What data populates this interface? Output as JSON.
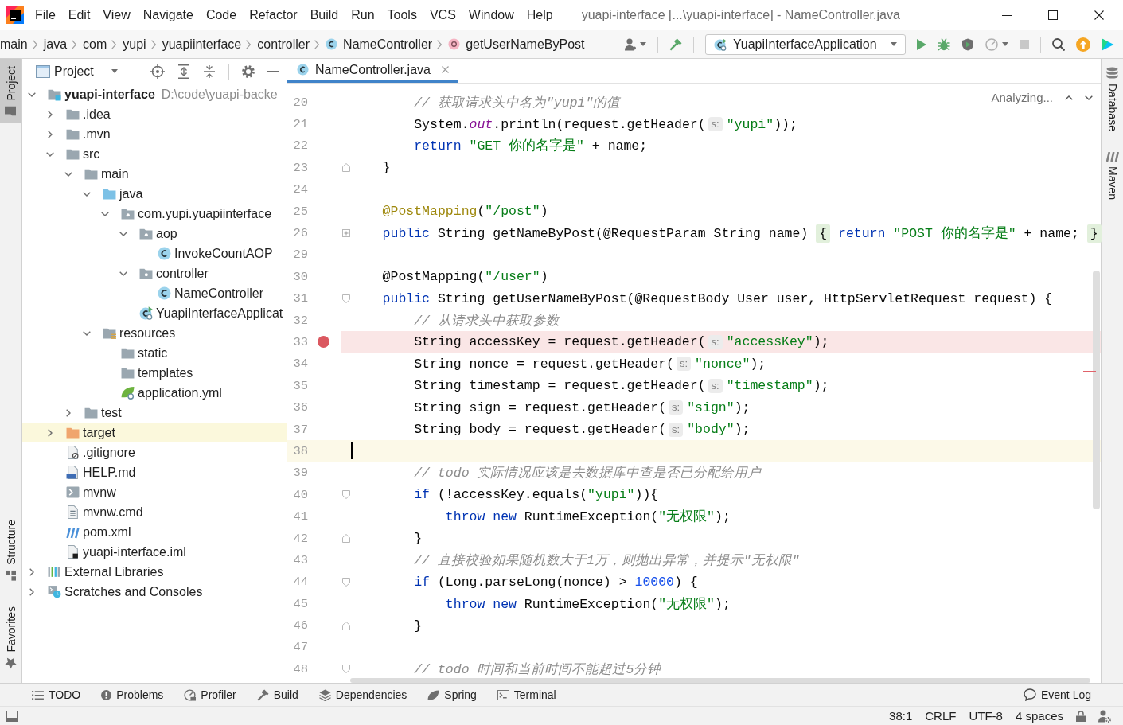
{
  "window": {
    "title": "yuapi-interface [...\\yuapi-interface] - NameController.java"
  },
  "menu": [
    {
      "label": "File"
    },
    {
      "label": "Edit"
    },
    {
      "label": "View"
    },
    {
      "label": "Navigate"
    },
    {
      "label": "Code"
    },
    {
      "label": "Refactor"
    },
    {
      "label": "Build"
    },
    {
      "label": "Run"
    },
    {
      "label": "Tools"
    },
    {
      "label": "VCS"
    },
    {
      "label": "Window"
    },
    {
      "label": "Help"
    }
  ],
  "breadcrumbs": [
    {
      "label": "main",
      "kind": "folder"
    },
    {
      "label": "java",
      "kind": "folder"
    },
    {
      "label": "com",
      "kind": "folder"
    },
    {
      "label": "yupi",
      "kind": "folder"
    },
    {
      "label": "yuapiinterface",
      "kind": "folder"
    },
    {
      "label": "controller",
      "kind": "folder"
    },
    {
      "label": "NameController",
      "kind": "class"
    },
    {
      "label": "getUserNameByPost",
      "kind": "method"
    }
  ],
  "run_config": {
    "label": "YuapiInterfaceApplication"
  },
  "left_tool_stripe": [
    {
      "label": "Project",
      "selected": true
    },
    {
      "label": "Structure",
      "selected": false
    },
    {
      "label": "Favorites",
      "selected": false
    }
  ],
  "project_panel": {
    "title": "Project",
    "tree": [
      {
        "label": "yuapi-interface",
        "path": "D:\\code\\yuapi-backe",
        "kind": "module",
        "expanded": true,
        "selected": false,
        "children": [
          {
            "label": ".idea",
            "kind": "folder",
            "expanded": false,
            "selected": false
          },
          {
            "label": ".mvn",
            "kind": "folder",
            "expanded": false,
            "selected": false
          },
          {
            "label": "src",
            "kind": "folder",
            "expanded": true,
            "selected": false,
            "children": [
              {
                "label": "main",
                "kind": "folder",
                "expanded": true,
                "selected": false,
                "children": [
                  {
                    "label": "java",
                    "kind": "source-root",
                    "expanded": true,
                    "selected": false,
                    "children": [
                      {
                        "label": "com.yupi.yuapiinterface",
                        "kind": "package",
                        "expanded": true,
                        "selected": false,
                        "children": [
                          {
                            "label": "aop",
                            "kind": "package",
                            "expanded": true,
                            "selected": false,
                            "children": [
                              {
                                "label": "InvokeCountAOP",
                                "kind": "class",
                                "selected": false
                              }
                            ]
                          },
                          {
                            "label": "controller",
                            "kind": "package",
                            "expanded": true,
                            "selected": false,
                            "children": [
                              {
                                "label": "NameController",
                                "kind": "class",
                                "selected": false
                              }
                            ]
                          },
                          {
                            "label": "YuapiInterfaceApplicat",
                            "kind": "spring-app",
                            "selected": false
                          }
                        ]
                      }
                    ]
                  },
                  {
                    "label": "resources",
                    "kind": "resources-root",
                    "expanded": true,
                    "selected": false,
                    "children": [
                      {
                        "label": "static",
                        "kind": "folder",
                        "selected": false
                      },
                      {
                        "label": "templates",
                        "kind": "folder",
                        "selected": false
                      },
                      {
                        "label": "application.yml",
                        "kind": "spring-config",
                        "selected": false
                      }
                    ]
                  }
                ]
              },
              {
                "label": "test",
                "kind": "folder",
                "expanded": false,
                "selected": false
              }
            ]
          },
          {
            "label": "target",
            "kind": "excluded-folder",
            "expanded": false,
            "selected": true
          },
          {
            "label": ".gitignore",
            "kind": "ignored-file",
            "selected": false
          },
          {
            "label": "HELP.md",
            "kind": "markdown",
            "selected": false
          },
          {
            "label": "mvnw",
            "kind": "script",
            "selected": false
          },
          {
            "label": "mvnw.cmd",
            "kind": "text-file",
            "selected": false
          },
          {
            "label": "pom.xml",
            "kind": "maven",
            "selected": false
          },
          {
            "label": "yuapi-interface.iml",
            "kind": "module-file",
            "selected": false
          }
        ]
      },
      {
        "label": "External Libraries",
        "kind": "libraries",
        "expanded": false,
        "selected": false
      },
      {
        "label": "Scratches and Consoles",
        "kind": "scratches",
        "expanded": false,
        "selected": false
      }
    ]
  },
  "editor": {
    "tabs": [
      {
        "label": "NameController.java",
        "selected": true
      }
    ],
    "status": "Analyzing...",
    "lines": [
      {
        "number": "20",
        "kind": "plain",
        "breakpoint": false,
        "caret": false,
        "parts": [
          {
            "kind": "comment",
            "text": "        // 获取请求头中名为\"yupi\"的值"
          }
        ]
      },
      {
        "number": "21",
        "kind": "plain",
        "breakpoint": false,
        "caret": false,
        "parts": [
          {
            "kind": "plain",
            "text": "        System."
          },
          {
            "kind": "field",
            "text": "out"
          },
          {
            "kind": "plain",
            "text": ".println(request.getHeader("
          },
          {
            "kind": "hint",
            "text": "s:"
          },
          {
            "kind": "string",
            "text": "\"yupi\""
          },
          {
            "kind": "plain",
            "text": "));"
          }
        ]
      },
      {
        "number": "22",
        "kind": "plain",
        "breakpoint": false,
        "caret": false,
        "parts": [
          {
            "kind": "keyword",
            "text": "        return "
          },
          {
            "kind": "string",
            "text": "\"GET 你的名字是\""
          },
          {
            "kind": "plain",
            "text": " + name;"
          }
        ]
      },
      {
        "number": "23",
        "kind": "fold-end",
        "breakpoint": false,
        "caret": false,
        "parts": [
          {
            "kind": "plain",
            "text": "    }"
          }
        ]
      },
      {
        "number": "24",
        "kind": "plain",
        "breakpoint": false,
        "caret": false
      },
      {
        "number": "25",
        "kind": "plain",
        "breakpoint": false,
        "caret": false,
        "parts": [
          {
            "kind": "annotation",
            "text": "    @PostMapping"
          },
          {
            "kind": "plain",
            "text": "("
          },
          {
            "kind": "string",
            "text": "\"/post\""
          },
          {
            "kind": "plain",
            "text": ")"
          }
        ]
      },
      {
        "number": "26",
        "kind": "folded",
        "breakpoint": false,
        "caret": false,
        "parts": [
          {
            "kind": "keyword",
            "text": "    public"
          },
          {
            "kind": "plain",
            "text": " String getNameByPost(@RequestParam String name) "
          },
          {
            "kind": "folded",
            "text": "{"
          },
          {
            "kind": "keyword",
            "text": " return "
          },
          {
            "kind": "string",
            "text": "\"POST 你的名字是\""
          },
          {
            "kind": "plain",
            "text": " + name; "
          },
          {
            "kind": "folded",
            "text": "}"
          }
        ]
      },
      {
        "number": "29",
        "kind": "plain",
        "breakpoint": false,
        "caret": false
      },
      {
        "number": "30",
        "kind": "plain",
        "breakpoint": false,
        "caret": false,
        "parts": [
          {
            "kind": "plain",
            "text": "    @PostMapping("
          },
          {
            "kind": "string",
            "text": "\"/user\""
          },
          {
            "kind": "plain",
            "text": ")"
          }
        ]
      },
      {
        "number": "31",
        "kind": "fold-start",
        "breakpoint": false,
        "caret": false,
        "parts": [
          {
            "kind": "keyword",
            "text": "    public"
          },
          {
            "kind": "plain",
            "text": " String getUserNameByPost(@RequestBody User user, HttpServletRequest request) {"
          }
        ]
      },
      {
        "number": "32",
        "kind": "plain",
        "breakpoint": false,
        "caret": false,
        "parts": [
          {
            "kind": "comment",
            "text": "        // 从请求头中获取参数"
          }
        ]
      },
      {
        "number": "33",
        "kind": "plain",
        "breakpoint": true,
        "caret": false,
        "parts": [
          {
            "kind": "plain",
            "text": "        String accessKey = request.getHeader("
          },
          {
            "kind": "hint",
            "text": "s:"
          },
          {
            "kind": "string",
            "text": "\"accessKey\""
          },
          {
            "kind": "plain",
            "text": ");"
          }
        ]
      },
      {
        "number": "34",
        "kind": "plain",
        "breakpoint": false,
        "caret": false,
        "parts": [
          {
            "kind": "plain",
            "text": "        String nonce = request.getHeader("
          },
          {
            "kind": "hint",
            "text": "s:"
          },
          {
            "kind": "string",
            "text": "\"nonce\""
          },
          {
            "kind": "plain",
            "text": ");"
          }
        ]
      },
      {
        "number": "35",
        "kind": "plain",
        "breakpoint": false,
        "caret": false,
        "parts": [
          {
            "kind": "plain",
            "text": "        String timestamp = request.getHeader("
          },
          {
            "kind": "hint",
            "text": "s:"
          },
          {
            "kind": "string",
            "text": "\"timestamp\""
          },
          {
            "kind": "plain",
            "text": ");"
          }
        ]
      },
      {
        "number": "36",
        "kind": "plain",
        "breakpoint": false,
        "caret": false,
        "parts": [
          {
            "kind": "plain",
            "text": "        String sign = request.getHeader("
          },
          {
            "kind": "hint",
            "text": "s:"
          },
          {
            "kind": "string",
            "text": "\"sign\""
          },
          {
            "kind": "plain",
            "text": ");"
          }
        ]
      },
      {
        "number": "37",
        "kind": "plain",
        "breakpoint": false,
        "caret": false,
        "parts": [
          {
            "kind": "plain",
            "text": "        String body = request.getHeader("
          },
          {
            "kind": "hint",
            "text": "s:"
          },
          {
            "kind": "string",
            "text": "\"body\""
          },
          {
            "kind": "plain",
            "text": ");"
          }
        ]
      },
      {
        "number": "38",
        "kind": "plain",
        "breakpoint": false,
        "caret": true
      },
      {
        "number": "39",
        "kind": "plain",
        "breakpoint": false,
        "caret": false,
        "parts": [
          {
            "kind": "comment",
            "text": "        // todo 实际情况应该是去数据库中查是否已分配给用户"
          }
        ]
      },
      {
        "number": "40",
        "kind": "fold-start",
        "breakpoint": false,
        "caret": false,
        "parts": [
          {
            "kind": "keyword",
            "text": "        if"
          },
          {
            "kind": "plain",
            "text": " (!accessKey.equals("
          },
          {
            "kind": "string",
            "text": "\"yupi\""
          },
          {
            "kind": "plain",
            "text": ")){"
          }
        ]
      },
      {
        "number": "41",
        "kind": "plain",
        "breakpoint": false,
        "caret": false,
        "parts": [
          {
            "kind": "keyword",
            "text": "            throw new"
          },
          {
            "kind": "plain",
            "text": " RuntimeException("
          },
          {
            "kind": "string",
            "text": "\"无权限\""
          },
          {
            "kind": "plain",
            "text": ");"
          }
        ]
      },
      {
        "number": "42",
        "kind": "fold-end",
        "breakpoint": false,
        "caret": false,
        "parts": [
          {
            "kind": "plain",
            "text": "        }"
          }
        ]
      },
      {
        "number": "43",
        "kind": "plain",
        "breakpoint": false,
        "caret": false,
        "parts": [
          {
            "kind": "comment",
            "text": "        // 直接校验如果随机数大于1万，则抛出异常，并提示\"无权限\""
          }
        ]
      },
      {
        "number": "44",
        "kind": "fold-start",
        "breakpoint": false,
        "caret": false,
        "parts": [
          {
            "kind": "keyword",
            "text": "        if"
          },
          {
            "kind": "plain",
            "text": " (Long.parseLong(nonce) > "
          },
          {
            "kind": "number",
            "text": "10000"
          },
          {
            "kind": "plain",
            "text": ") {"
          }
        ]
      },
      {
        "number": "45",
        "kind": "plain",
        "breakpoint": false,
        "caret": false,
        "parts": [
          {
            "kind": "keyword",
            "text": "            throw new"
          },
          {
            "kind": "plain",
            "text": " RuntimeException("
          },
          {
            "kind": "string",
            "text": "\"无权限\""
          },
          {
            "kind": "plain",
            "text": ");"
          }
        ]
      },
      {
        "number": "46",
        "kind": "fold-end",
        "breakpoint": false,
        "caret": false,
        "parts": [
          {
            "kind": "plain",
            "text": "        }"
          }
        ]
      },
      {
        "number": "47",
        "kind": "plain",
        "breakpoint": false,
        "caret": false
      },
      {
        "number": "48",
        "kind": "fold-start",
        "breakpoint": false,
        "caret": false,
        "parts": [
          {
            "kind": "comment",
            "text": "        // todo 时间和当前时间不能超过5分钟"
          }
        ]
      }
    ]
  },
  "right_tool_stripe": [
    {
      "label": "Database"
    },
    {
      "label": "Maven"
    }
  ],
  "tool_windows": [
    {
      "label": "TODO"
    },
    {
      "label": "Problems"
    },
    {
      "label": "Profiler"
    },
    {
      "label": "Build"
    },
    {
      "label": "Dependencies"
    },
    {
      "label": "Spring"
    },
    {
      "label": "Terminal"
    }
  ],
  "event_log": {
    "label": "Event Log"
  },
  "status_bar": {
    "caret_position": "38:1",
    "line_separator": "CRLF",
    "encoding": "UTF-8",
    "indent": "4 spaces"
  }
}
